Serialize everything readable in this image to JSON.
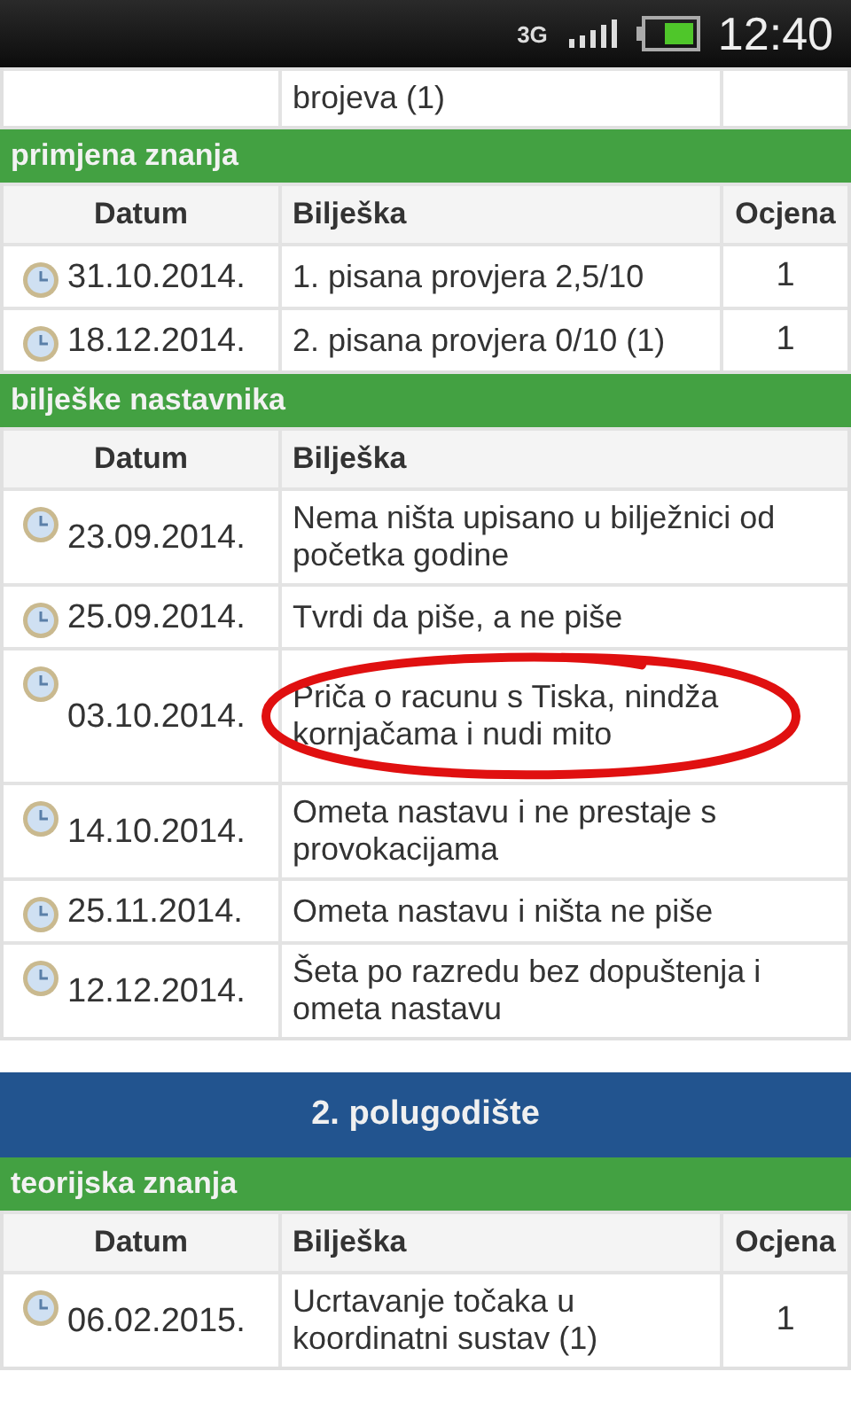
{
  "status_bar": {
    "network": "3G",
    "time": "12:40"
  },
  "blocks": [
    {
      "kind": "table",
      "rows": [
        {
          "note": "brojeva (1)"
        }
      ]
    },
    {
      "kind": "category",
      "title": "primjena znanja"
    },
    {
      "kind": "table",
      "columns": [
        "Datum",
        "Bilješka",
        "Ocjena"
      ],
      "rows": [
        {
          "date": "31.10.2014.",
          "note": "1. pisana provjera 2,5/10",
          "grade": "1"
        },
        {
          "date": "18.12.2014.",
          "note": "2. pisana provjera 0/10 (1)",
          "grade": "1"
        }
      ]
    },
    {
      "kind": "category",
      "title": "bilješke nastavnika"
    },
    {
      "kind": "table",
      "columns": [
        "Datum",
        "Bilješka"
      ],
      "rows": [
        {
          "date": "23.09.2014.",
          "note": "Nema ništa upisano u bilježnici od početka godine"
        },
        {
          "date": "25.09.2014.",
          "note": "Tvrdi da piše, a ne piše"
        },
        {
          "date": "03.10.2014.",
          "note": "Priča o racunu s Tiska, nindža kornjačama i nudi mito",
          "circled": true
        },
        {
          "date": "14.10.2014.",
          "note": "Ometa nastavu i ne prestaje s provokacijama"
        },
        {
          "date": "25.11.2014.",
          "note": "Ometa nastavu i ništa ne piše"
        },
        {
          "date": "12.12.2014.",
          "note": "Šeta po razredu bez dopuštenja i ometa nastavu"
        }
      ]
    },
    {
      "kind": "semester",
      "title": "2. polugodište"
    },
    {
      "kind": "category",
      "title": "teorijska znanja"
    },
    {
      "kind": "table",
      "columns": [
        "Datum",
        "Bilješka",
        "Ocjena"
      ],
      "rows": [
        {
          "date": "06.02.2015.",
          "note": "Ucrtavanje točaka u koordinatni sustav (1)",
          "grade": "1"
        }
      ]
    }
  ]
}
